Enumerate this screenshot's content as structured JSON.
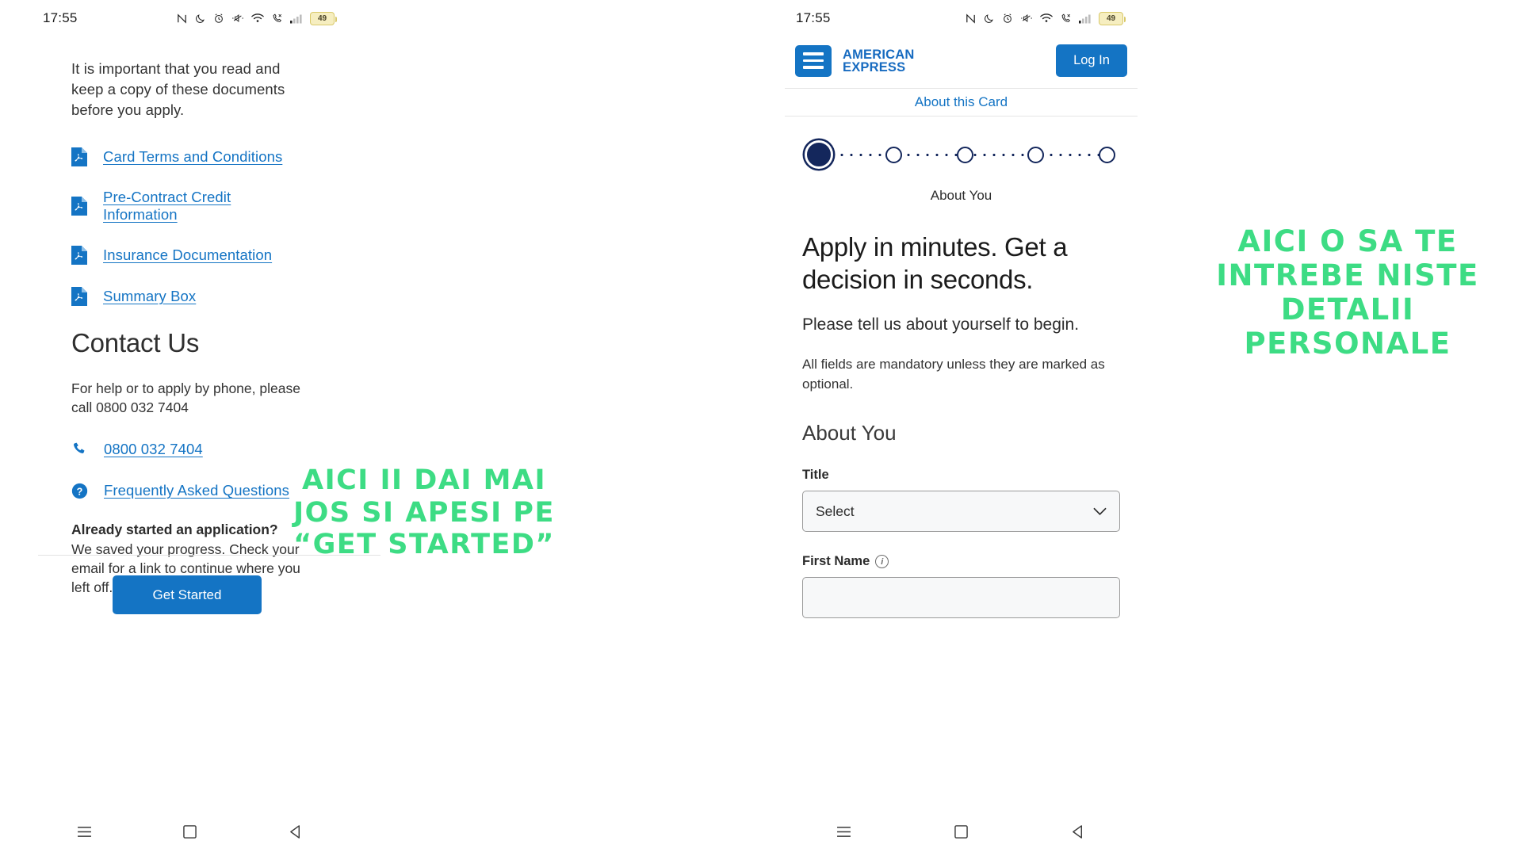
{
  "status_bar": {
    "time": "17:55",
    "battery_level": "49",
    "icons": [
      "nfc-icon",
      "moon-icon",
      "alarm-icon",
      "mute-icon",
      "wifi-icon",
      "missed-call-icon",
      "signal-icon",
      "battery-icon"
    ]
  },
  "left_phone": {
    "intro": "It is important that you read and keep a copy of these documents before you apply.",
    "documents": [
      {
        "label": "Card Terms and Conditions",
        "icon": "pdf-icon"
      },
      {
        "label": "Pre-Contract Credit Information",
        "icon": "pdf-icon"
      },
      {
        "label": "Insurance Documentation",
        "icon": "pdf-icon"
      },
      {
        "label": "Summary Box",
        "icon": "pdf-icon"
      }
    ],
    "contact_heading": "Contact Us",
    "contact_text": "For help or to apply by phone, please call 0800 032 7404",
    "phone_link": "0800 032 7404",
    "faq_link": "Frequently Asked Questions",
    "resume_heading": "Already started an application?",
    "resume_text": "We saved your progress. Check your email for a link to continue where you left off.",
    "get_started_label": "Get Started"
  },
  "right_phone": {
    "brand_line1": "AMERICAN",
    "brand_line2": "EXPRESS",
    "login_label": "Log In",
    "sub_nav_label": "About this Card",
    "stepper": {
      "total_steps": 5,
      "active_step": 1,
      "label": "About You"
    },
    "headline": "Apply in minutes. Get a decision in seconds.",
    "lead": "Please tell us about yourself to begin.",
    "note": "All fields are mandatory unless they are marked as optional.",
    "section_heading": "About You",
    "fields": [
      {
        "label": "Title",
        "type": "select",
        "value": "Select"
      },
      {
        "label": "First Name",
        "type": "text",
        "value": "",
        "has_info_icon": true
      }
    ]
  },
  "annotations": {
    "left": "AICI II DAI MAI JOS SI APESI PE “GET STARTED”",
    "right": "AICI O SA TE INTREBE NISTE DETALII PERSONALE",
    "color": "#3ddc84"
  },
  "nav_bar": {
    "recents_label": "recents-icon",
    "home_label": "home-icon",
    "back_label": "back-icon"
  }
}
